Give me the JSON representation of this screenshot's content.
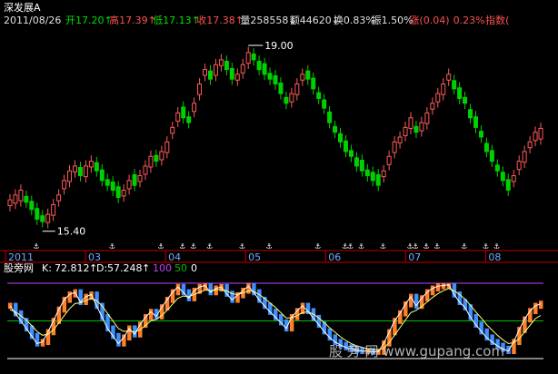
{
  "header": {
    "title": "深发展A",
    "date": "2011/08/26",
    "stats": [
      {
        "label": "开",
        "value": "17.20",
        "arrow": "↑",
        "color": "#00e000"
      },
      {
        "label": "高",
        "value": "17.39",
        "arrow": "↑",
        "color": "#ff5050"
      },
      {
        "label": "低",
        "value": "17.13",
        "arrow": "↑",
        "color": "#00e000"
      },
      {
        "label": "收",
        "value": "17.38",
        "arrow": "↑",
        "color": "#ff5050"
      },
      {
        "label": "量",
        "value": "258558",
        "arrow": "↓",
        "color": "#e0e0e0"
      },
      {
        "label": "额",
        "value": "44620",
        "arrow": "↓",
        "color": "#e0e0e0"
      },
      {
        "label": "换",
        "value": "0.83%",
        "arrow": "",
        "color": "#e0e0e0"
      },
      {
        "label": "振",
        "value": "1.50%",
        "arrow": "",
        "color": "#e0e0e0"
      },
      {
        "label": "涨",
        "value": "(0.04)",
        "arrow": "",
        "color": "#ff5050"
      },
      {
        "label": "",
        "value": "0.23%",
        "arrow": "",
        "color": "#ff5050"
      },
      {
        "label": "指数",
        "value": "(",
        "arrow": "",
        "color": "#ff5050"
      }
    ]
  },
  "lower_panel": {
    "name": "股旁网",
    "k_label": "K:",
    "k_value": "72.812",
    "k_arrow": "↑",
    "d_label": "D:",
    "d_value": "57.248",
    "d_arrow": "↑",
    "level_high": "100",
    "level_mid": "50",
    "level_low": "0"
  },
  "watermark": "股 旁 网  www.gupang.com",
  "colors": {
    "up": "#ff5a5a",
    "down": "#00d000",
    "axis": "#c00000",
    "bar_up": "#ff7f2a",
    "bar_down": "#3f8fff",
    "line_100": "#c040ff",
    "line_50": "#00c000"
  },
  "chart_data": [
    {
      "type": "candlestick",
      "title": "深发展A",
      "x_ticks": [
        "2011",
        "03",
        "04",
        "05",
        "06",
        "07",
        "08"
      ],
      "annotations": [
        {
          "text": "19.00",
          "kind": "high"
        },
        {
          "text": "15.40",
          "kind": "low"
        }
      ],
      "ylim": [
        15.0,
        19.4
      ],
      "close": [
        15.9,
        16.0,
        16.1,
        15.85,
        15.7,
        15.5,
        15.45,
        15.6,
        15.8,
        16.0,
        16.3,
        16.5,
        16.6,
        16.4,
        16.6,
        16.7,
        16.5,
        16.3,
        16.2,
        16.1,
        15.95,
        16.1,
        16.3,
        16.2,
        16.4,
        16.6,
        16.8,
        16.7,
        16.9,
        17.1,
        17.4,
        17.7,
        17.6,
        17.5,
        17.9,
        18.3,
        18.6,
        18.4,
        18.7,
        18.8,
        18.6,
        18.4,
        18.5,
        18.7,
        18.95,
        18.8,
        18.6,
        18.5,
        18.4,
        18.3,
        18.1,
        17.9,
        18.1,
        18.3,
        18.5,
        18.4,
        18.2,
        18.0,
        17.8,
        17.5,
        17.3,
        17.1,
        16.9,
        16.8,
        16.6,
        16.5,
        16.4,
        16.3,
        16.2,
        16.5,
        16.8,
        17.1,
        17.2,
        17.4,
        17.6,
        17.3,
        17.5,
        17.7,
        17.9,
        18.1,
        18.3,
        18.5,
        18.2,
        18.0,
        17.9,
        17.6,
        17.4,
        17.2,
        16.9,
        16.7,
        16.5,
        16.3,
        16.1,
        16.4,
        16.7,
        16.9,
        17.1,
        17.3,
        17.38
      ],
      "bar_colors": [
        "u",
        "u",
        "u",
        "d",
        "d",
        "d",
        "d",
        "u",
        "u",
        "u",
        "u",
        "u",
        "u",
        "d",
        "u",
        "u",
        "d",
        "d",
        "d",
        "d",
        "d",
        "u",
        "u",
        "d",
        "u",
        "u",
        "u",
        "d",
        "u",
        "u",
        "u",
        "u",
        "d",
        "d",
        "u",
        "u",
        "u",
        "d",
        "u",
        "u",
        "d",
        "d",
        "u",
        "u",
        "u",
        "d",
        "d",
        "d",
        "d",
        "d",
        "d",
        "d",
        "u",
        "u",
        "u",
        "d",
        "d",
        "d",
        "d",
        "d",
        "d",
        "d",
        "d",
        "d",
        "d",
        "d",
        "d",
        "d",
        "d",
        "u",
        "u",
        "u",
        "u",
        "u",
        "u",
        "d",
        "u",
        "u",
        "u",
        "u",
        "u",
        "u",
        "d",
        "d",
        "d",
        "d",
        "d",
        "d",
        "d",
        "d",
        "d",
        "d",
        "d",
        "u",
        "u",
        "u",
        "u",
        "u",
        "u"
      ]
    },
    {
      "type": "oscillator",
      "name": "股旁网",
      "series": [
        {
          "name": "K",
          "last": 72.812
        },
        {
          "name": "D",
          "last": 57.248
        }
      ],
      "levels": [
        100,
        50,
        0
      ],
      "ylim": [
        0,
        100
      ],
      "k": [
        70,
        60,
        50,
        40,
        30,
        20,
        22,
        35,
        50,
        65,
        78,
        85,
        88,
        75,
        82,
        85,
        70,
        55,
        40,
        30,
        20,
        28,
        40,
        32,
        45,
        55,
        62,
        56,
        68,
        78,
        88,
        95,
        88,
        80,
        90,
        95,
        97,
        88,
        93,
        95,
        86,
        78,
        84,
        90,
        96,
        88,
        78,
        70,
        62,
        55,
        48,
        40,
        55,
        63,
        70,
        63,
        54,
        45,
        36,
        28,
        22,
        18,
        15,
        13,
        11,
        10,
        10,
        9,
        9,
        20,
        35,
        50,
        60,
        72,
        82,
        70,
        80,
        88,
        93,
        96,
        97,
        98,
        85,
        75,
        68,
        55,
        45,
        36,
        28,
        22,
        17,
        13,
        10,
        22,
        38,
        52,
        63,
        70,
        72.8
      ],
      "d": [
        65,
        62,
        57,
        51,
        44,
        36,
        31,
        32,
        38,
        47,
        57,
        66,
        73,
        74,
        77,
        80,
        77,
        70,
        60,
        50,
        40,
        36,
        37,
        35,
        38,
        44,
        50,
        52,
        57,
        64,
        72,
        80,
        83,
        82,
        85,
        88,
        91,
        90,
        91,
        92,
        90,
        86,
        85,
        87,
        90,
        89,
        85,
        80,
        74,
        68,
        61,
        54,
        54,
        57,
        61,
        62,
        59,
        54,
        48,
        41,
        35,
        29,
        24,
        20,
        17,
        15,
        13,
        12,
        11,
        14,
        21,
        31,
        41,
        51,
        61,
        64,
        69,
        75,
        81,
        86,
        90,
        93,
        90,
        85,
        79,
        71,
        62,
        54,
        45,
        38,
        31,
        25,
        20,
        21,
        26,
        35,
        44,
        53,
        57.2
      ]
    }
  ]
}
